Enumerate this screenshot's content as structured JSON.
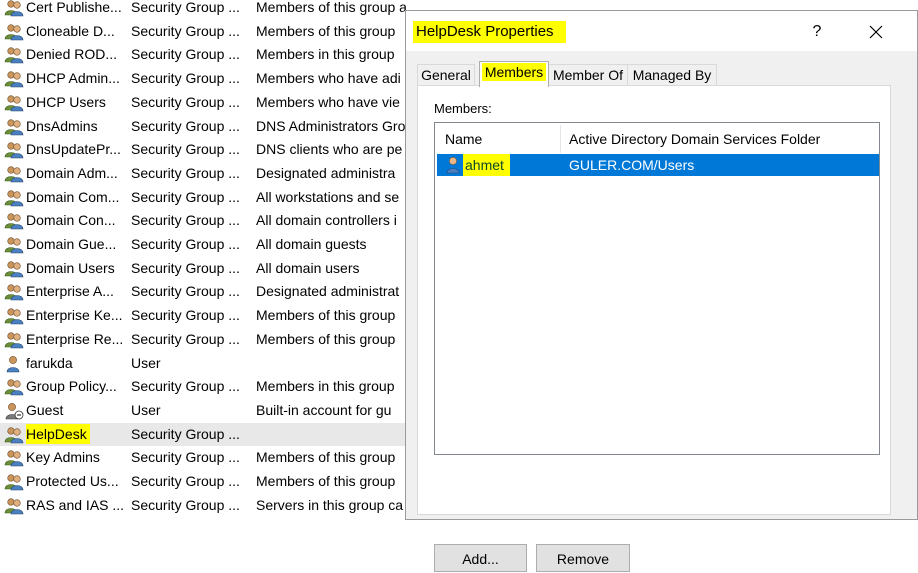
{
  "list": {
    "rows": [
      {
        "name": "Cert Publishe...",
        "type": "Security Group ...",
        "desc": "Members of this group a",
        "icon": "group-icon"
      },
      {
        "name": "Cloneable D...",
        "type": "Security Group ...",
        "desc": "Members of this group",
        "icon": "group-icon"
      },
      {
        "name": "Denied ROD...",
        "type": "Security Group ...",
        "desc": "Members in this group",
        "icon": "group-icon"
      },
      {
        "name": "DHCP Admin...",
        "type": "Security Group ...",
        "desc": "Members who have adi",
        "icon": "group-icon"
      },
      {
        "name": "DHCP Users",
        "type": "Security Group ...",
        "desc": "Members who have vie",
        "icon": "group-icon"
      },
      {
        "name": "DnsAdmins",
        "type": "Security Group ...",
        "desc": "DNS Administrators Gro",
        "icon": "group-icon"
      },
      {
        "name": "DnsUpdatePr...",
        "type": "Security Group ...",
        "desc": "DNS clients who are pe",
        "icon": "group-icon"
      },
      {
        "name": "Domain Adm...",
        "type": "Security Group ...",
        "desc": "Designated administra",
        "icon": "group-icon"
      },
      {
        "name": "Domain Com...",
        "type": "Security Group ...",
        "desc": "All workstations and se",
        "icon": "group-icon"
      },
      {
        "name": "Domain Con...",
        "type": "Security Group ...",
        "desc": "All domain controllers i",
        "icon": "group-icon"
      },
      {
        "name": "Domain Gue...",
        "type": "Security Group ...",
        "desc": "All domain guests",
        "icon": "group-icon"
      },
      {
        "name": "Domain Users",
        "type": "Security Group ...",
        "desc": "All domain users",
        "icon": "group-icon"
      },
      {
        "name": "Enterprise A...",
        "type": "Security Group ...",
        "desc": "Designated administrat",
        "icon": "group-icon"
      },
      {
        "name": "Enterprise Ke...",
        "type": "Security Group ...",
        "desc": "Members of this group",
        "icon": "group-icon"
      },
      {
        "name": "Enterprise Re...",
        "type": "Security Group ...",
        "desc": "Members of this group",
        "icon": "group-icon"
      },
      {
        "name": "farukda",
        "type": "User",
        "desc": "",
        "icon": "user-icon"
      },
      {
        "name": "Group Policy...",
        "type": "Security Group ...",
        "desc": "Members in this group",
        "icon": "group-icon"
      },
      {
        "name": "Guest",
        "type": "User",
        "desc": "Built-in account for gu",
        "icon": "disabled-user-icon"
      },
      {
        "name": "HelpDesk",
        "type": "Security Group ...",
        "desc": "",
        "icon": "group-icon",
        "selected": true
      },
      {
        "name": "Key Admins",
        "type": "Security Group ...",
        "desc": "Members of this group",
        "icon": "group-icon"
      },
      {
        "name": "Protected Us...",
        "type": "Security Group ...",
        "desc": "Members of this group",
        "icon": "group-icon"
      },
      {
        "name": "RAS and IAS ...",
        "type": "Security Group ...",
        "desc": "Servers in this group ca",
        "icon": "group-icon"
      }
    ]
  },
  "dialog": {
    "title": "HelpDesk Properties",
    "help_label": "?",
    "tabs": [
      "General",
      "Members",
      "Member Of",
      "Managed By"
    ],
    "active_tab": "Members",
    "members_label": "Members:",
    "columns": [
      "Name",
      "Active Directory Domain Services Folder"
    ],
    "members": [
      {
        "name": "ahmet",
        "folder": "GULER.COM/Users"
      }
    ],
    "add_label": "Add...",
    "remove_label": "Remove"
  },
  "colors": {
    "highlight": "#ffff00",
    "selection": "#0078d7"
  }
}
